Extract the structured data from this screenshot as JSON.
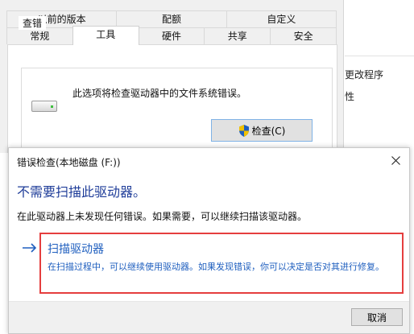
{
  "properties_window": {
    "tabs_row1": [
      "以前的版本",
      "配额",
      "自定义"
    ],
    "tabs_row2": [
      "常规",
      "工具",
      "硬件",
      "共享",
      "安全"
    ],
    "active_tab": "工具",
    "group_title": "查错",
    "group_description": "此选项将检查驱动器中的文件系统错误。",
    "check_button_label": "检查(C)"
  },
  "background_fragment": {
    "line1": "更改程序",
    "line2": "性"
  },
  "dialog": {
    "title": "错误检查(本地磁盘 (F:))",
    "heading": "不需要扫描此驱动器。",
    "info": "在此驱动器上未发现任何错误。如果需要，可以继续扫描该驱动器。",
    "action": {
      "title": "扫描驱动器",
      "description": "在扫描过程中，可以继续使用驱动器。如果发现错误，你可以决定是否对其进行修复。"
    },
    "cancel_label": "取消"
  },
  "colors": {
    "heading": "#1f3d99",
    "link": "#1f5fbf",
    "highlight_border": "#e53e3e"
  },
  "icons": [
    "drive-icon",
    "shield-icon",
    "close-icon",
    "arrow-right-icon"
  ]
}
